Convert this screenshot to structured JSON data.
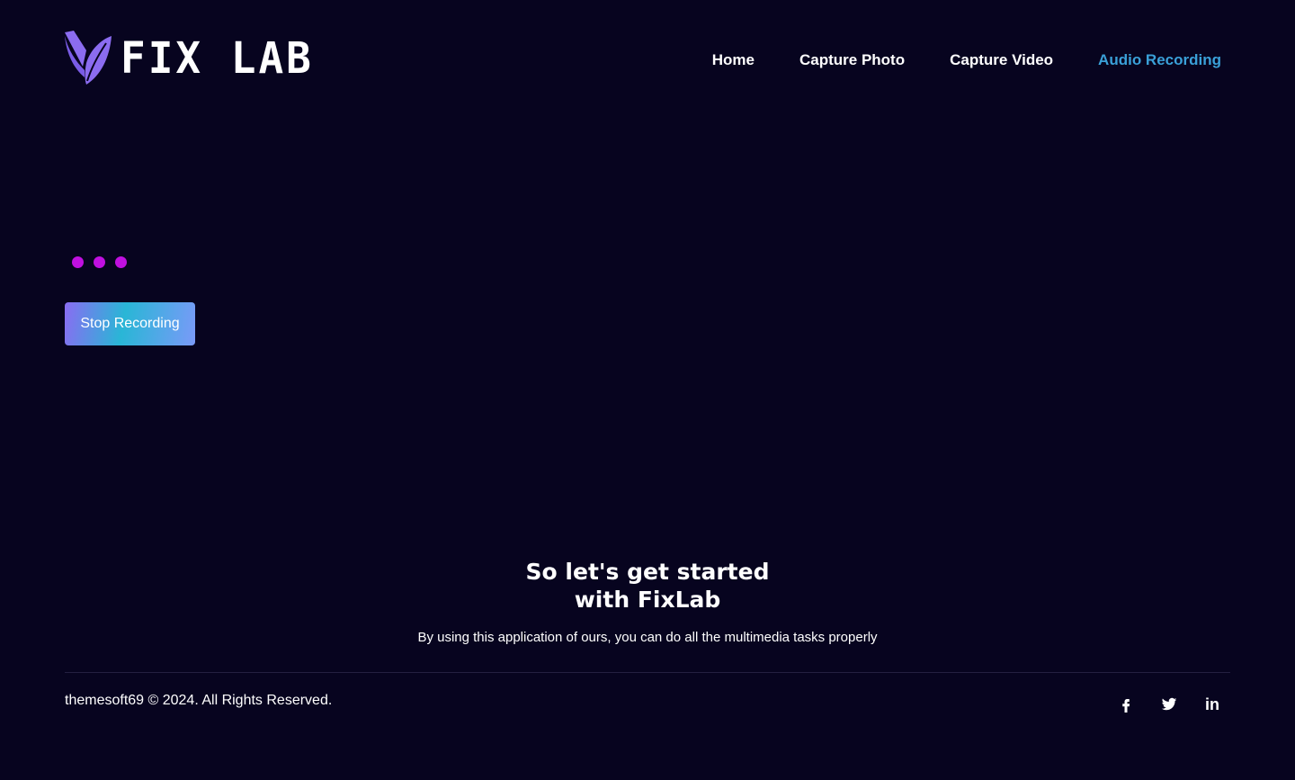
{
  "brand": {
    "name": "FIX LAB",
    "mark_color": "#8b6cf0"
  },
  "nav": {
    "items": [
      {
        "label": "Home"
      },
      {
        "label": "Capture Photo"
      },
      {
        "label": "Capture Video"
      },
      {
        "label": "Audio Recording",
        "active": true
      }
    ],
    "active_color": "#3aa0d8"
  },
  "recording": {
    "indicator_dots": 3,
    "dot_color": "#c010e0",
    "stop_button_label": "Stop Recording"
  },
  "cta": {
    "title_line1": "So let's get started",
    "title_line2": "with FixLab",
    "subtitle": "By using this application of ours, you can do all the multimedia tasks properly"
  },
  "footer": {
    "copyright": "themesoft69 © 2024. All Rights Reserved.",
    "socials": [
      {
        "icon": "facebook-icon"
      },
      {
        "icon": "twitter-icon"
      },
      {
        "icon": "linkedin-icon",
        "text": "in"
      }
    ]
  },
  "colors": {
    "background": "#07041f",
    "text": "#ffffff",
    "button_gradient": [
      "#8a6cf2",
      "#29b6d6",
      "#7a9af8"
    ]
  }
}
